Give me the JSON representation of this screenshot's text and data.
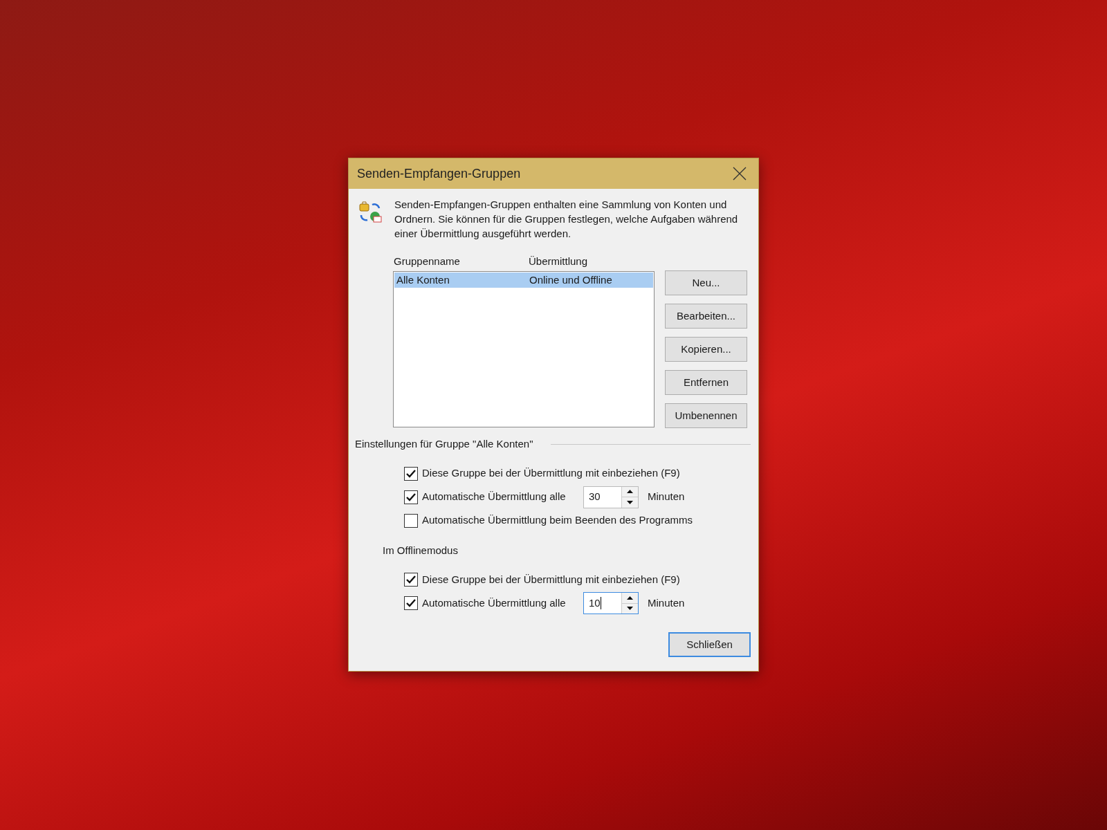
{
  "window": {
    "title": "Senden-Empfangen-Gruppen"
  },
  "description": "Senden-Empfangen-Gruppen enthalten eine Sammlung von Konten und Ordnern. Sie können für die Gruppen festlegen, welche Aufgaben während einer Übermittlung ausgeführt werden.",
  "table": {
    "columns": [
      "Gruppenname",
      "Übermittlung"
    ],
    "rows": [
      {
        "cells": [
          "Alle Konten",
          "Online und Offline"
        ],
        "selected": true
      }
    ]
  },
  "side_buttons": [
    "Neu...",
    "Bearbeiten...",
    "Kopieren...",
    "Entfernen",
    "Umbenennen"
  ],
  "group_settings": {
    "title": "Einstellungen für Gruppe \"Alle Konten\"",
    "options": [
      {
        "kind": "checkbox",
        "label": "Diese Gruppe bei der Übermittlung mit einbeziehen (F9)",
        "checked": true
      },
      {
        "kind": "interval",
        "label": "Automatische Übermittlung alle",
        "checked": true,
        "value": "30",
        "unit": "Minuten",
        "focused": false
      },
      {
        "kind": "checkbox",
        "label": "Automatische Übermittlung beim Beenden des Programms",
        "checked": false
      }
    ]
  },
  "offline": {
    "title": "Im Offlinemodus",
    "options": [
      {
        "kind": "checkbox",
        "label": "Diese Gruppe bei der Übermittlung mit einbeziehen (F9)",
        "checked": true
      },
      {
        "kind": "interval",
        "label": "Automatische Übermittlung alle",
        "checked": true,
        "value": "10",
        "unit": "Minuten",
        "focused": true
      }
    ]
  },
  "close_button": "Schließen"
}
